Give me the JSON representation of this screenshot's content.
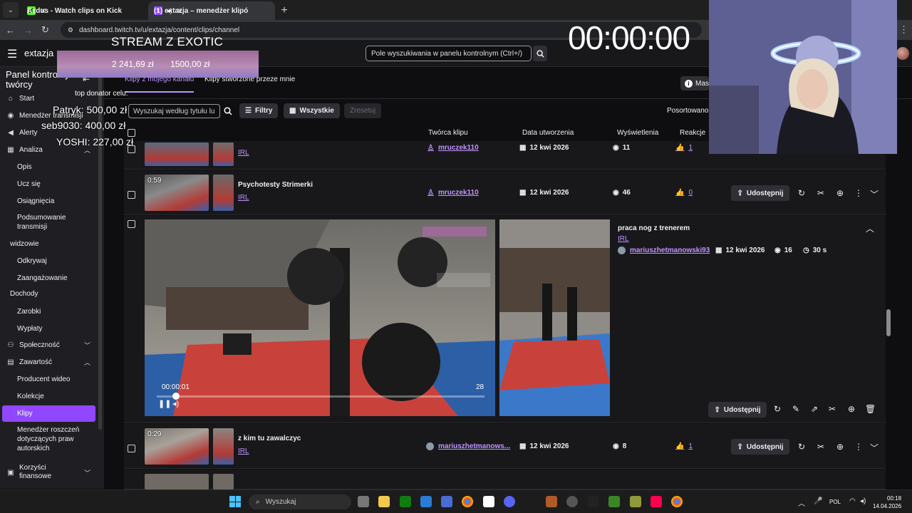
{
  "browser": {
    "tabs": [
      {
        "title": "Azdus - Watch clips on Kick",
        "favicon_color": "#53fc18",
        "active": false
      },
      {
        "title": "(1) extazja – menedżer klipó",
        "favicon_color": "#9147ff",
        "active": true
      }
    ],
    "url": "dashboard.twitch.tv/u/extazja/content/clips/channel"
  },
  "header": {
    "channel": "extazja",
    "search_placeholder": "Pole wyszukiwania w panelu kontrolnym (Ctrl+/)"
  },
  "overlay": {
    "stream_title": "STREAM Z EXOTIC",
    "amount_current": "2 241,69 zł",
    "amount_goal": "1500,00 zł",
    "top_label": "top donator celu:",
    "donors": [
      "Patryk: 500,00 zł",
      "seb9030: 400,00 zł",
      "YOSHI: 227,00 zł"
    ],
    "timer": "00:00:00"
  },
  "sidebar": {
    "title": "Panel kontrolny twórcy",
    "items": {
      "start": "Start",
      "menedzer": "Menedżer transmisji",
      "alerty": "Alerty",
      "analiza": "Analiza",
      "opis": "Opis",
      "ucz": "Ucz się",
      "osiagniecia": "Osiągnięcia",
      "podsumowanie": "Podsumowanie transmisji",
      "widzowie": "widzowie",
      "odkrywaj": "Odkrywaj",
      "zaangazowanie": "Zaangażowanie",
      "dochody": "Dochody",
      "zarobki": "Zarobki",
      "wyplaty": "Wypłaty",
      "spolecznosc": "Społeczność",
      "zawartosc": "Zawartość",
      "producent": "Producent wideo",
      "kolekcje": "Kolekcje",
      "klipy": "Klipy",
      "roszczenia": "Menedżer roszczeń dotyczących praw autorskich",
      "korzysci": "Korzyści finansowe"
    }
  },
  "tabs": {
    "mine": "Klipy z mojego kanału",
    "created": "Klipy stworzone przeze mnie",
    "mas": "Mas"
  },
  "filters": {
    "search_placeholder": "Wyszukaj według tytułu lu",
    "filtry": "Filtry",
    "wszystkie": "Wszystkie",
    "zresetuj": "Zresetuj",
    "sort": "Posortowano"
  },
  "columns": {
    "creator": "Twórca klipu",
    "date": "Data utworzenia",
    "views": "Wyświetlenia",
    "reactions": "Reakcje"
  },
  "rows": [
    {
      "title": "",
      "category": "IRL",
      "creator": "mruczek110",
      "date": "12 kwi 2026",
      "views": "11",
      "likes": "1"
    },
    {
      "duration": "0:59",
      "title": "Psychotesty Strimerki",
      "category": "IRL",
      "creator": "mruczek110",
      "date": "12 kwi 2026",
      "views": "46",
      "likes": "0",
      "share": "Udostępnij"
    },
    {
      "title": "praca nog z trenerem",
      "category": "IRL",
      "creator": "mariuszhetmanowski93",
      "date": "12 kwi 2026",
      "views": "16",
      "length": "30 s",
      "share": "Udostępnij",
      "player_time": "00:00:01",
      "player_count": "28",
      "progress": 0.05
    },
    {
      "duration": "0:29",
      "title": "z kim tu zawalczyc",
      "category": "IRL",
      "creator": "mariuszhetmanows...",
      "date": "12 kwi 2026",
      "views": "8",
      "likes": "1",
      "share": "Udostępnij"
    }
  ],
  "taskbar": {
    "search": "Wyszukaj",
    "lang": "POL",
    "time": "00:18",
    "date": "14.04.2026"
  },
  "colors": {
    "accent": "#9147ff",
    "link": "#bf94ff"
  }
}
